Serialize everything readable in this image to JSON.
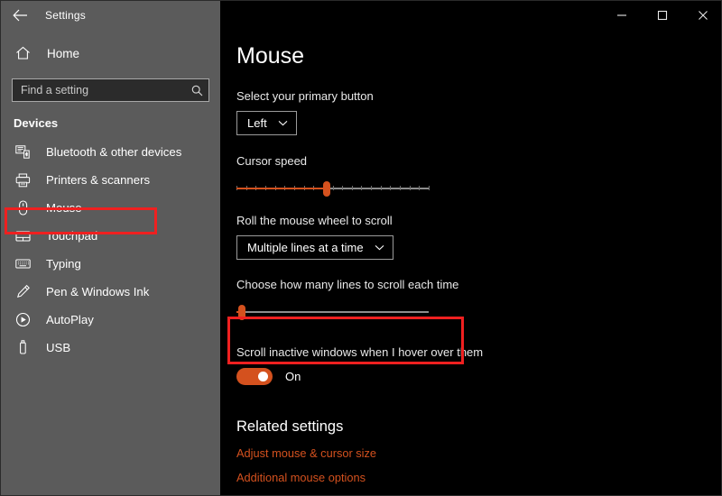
{
  "window": {
    "title": "Settings",
    "back_icon": "back-arrow-icon",
    "minimize_label": "—",
    "maximize_label": "□",
    "close_label": "✕"
  },
  "sidebar": {
    "home_label": "Home",
    "home_icon": "home-icon",
    "search": {
      "placeholder": "Find a setting",
      "value": "",
      "icon": "search-icon"
    },
    "section_title": "Devices",
    "items": [
      {
        "label": "Bluetooth & other devices",
        "icon": "bluetooth-devices-icon",
        "selected": false
      },
      {
        "label": "Printers & scanners",
        "icon": "printer-icon",
        "selected": false
      },
      {
        "label": "Mouse",
        "icon": "mouse-icon",
        "selected": true
      },
      {
        "label": "Touchpad",
        "icon": "touchpad-icon",
        "selected": false
      },
      {
        "label": "Typing",
        "icon": "keyboard-icon",
        "selected": false
      },
      {
        "label": "Pen & Windows Ink",
        "icon": "pen-icon",
        "selected": false
      },
      {
        "label": "AutoPlay",
        "icon": "autoplay-icon",
        "selected": false
      },
      {
        "label": "USB",
        "icon": "usb-icon",
        "selected": false
      }
    ]
  },
  "main": {
    "page_title": "Mouse",
    "primary_button": {
      "label": "Select your primary button",
      "value": "Left",
      "chevron_icon": "chevron-down-icon"
    },
    "cursor_speed": {
      "label": "Cursor speed",
      "percent": 47
    },
    "wheel_scroll": {
      "label": "Roll the mouse wheel to scroll",
      "value": "Multiple lines at a time",
      "chevron_icon": "chevron-down-icon"
    },
    "lines_to_scroll": {
      "label": "Choose how many lines to scroll each time",
      "percent": 3
    },
    "scroll_inactive": {
      "label": "Scroll inactive windows when I hover over them",
      "state_label": "On",
      "on": true
    },
    "related": {
      "title": "Related settings",
      "links": [
        "Adjust mouse & cursor size",
        "Additional mouse options"
      ]
    }
  },
  "colors": {
    "accent": "#d4511e",
    "sidebar_bg": "#5b5b5b",
    "content_bg": "#000000",
    "annotation": "#ef2020"
  }
}
